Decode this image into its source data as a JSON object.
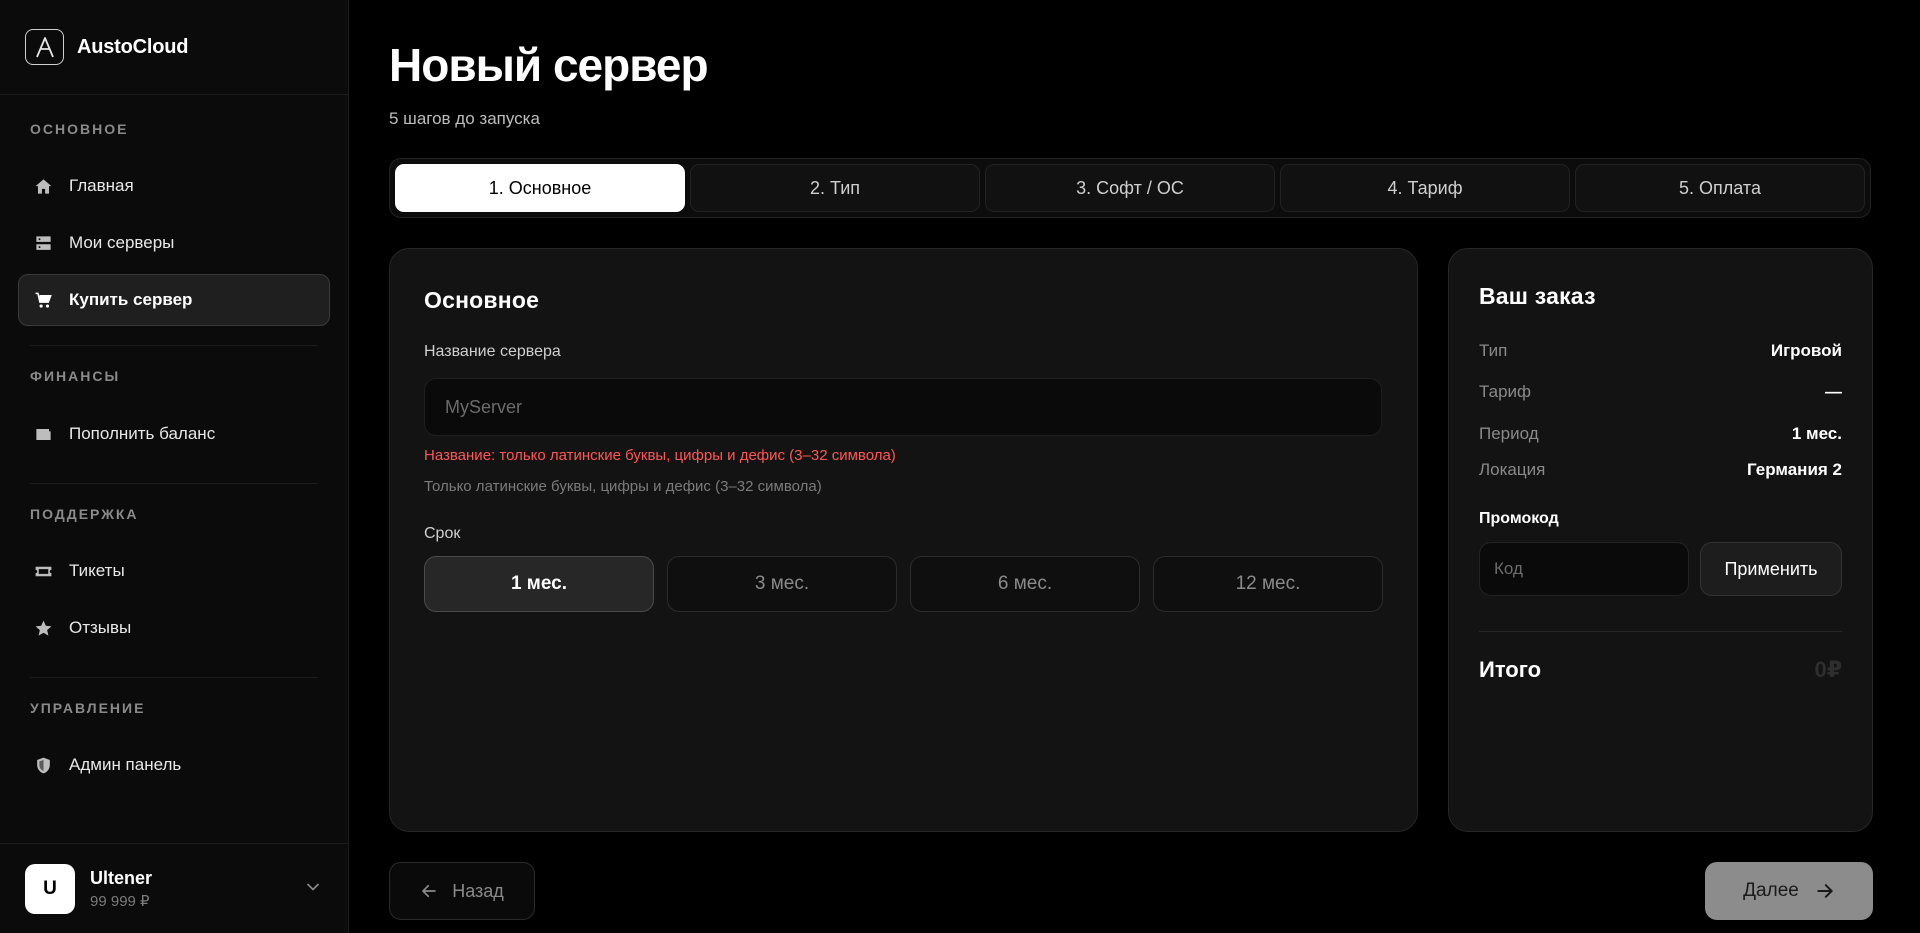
{
  "brand": {
    "logo_letter": "A",
    "name": "AustoCloud"
  },
  "sidebar": {
    "sections": [
      {
        "header": "ОСНОВНОЕ",
        "items": [
          {
            "label": "Главная",
            "icon": "home-icon"
          },
          {
            "label": "Мои серверы",
            "icon": "server-icon"
          },
          {
            "label": "Купить сервер",
            "icon": "cart-icon",
            "active": true
          }
        ]
      },
      {
        "header": "ФИНАНСЫ",
        "items": [
          {
            "label": "Пополнить баланс",
            "icon": "wallet-icon"
          }
        ]
      },
      {
        "header": "ПОДДЕРЖКА",
        "items": [
          {
            "label": "Тикеты",
            "icon": "ticket-icon"
          },
          {
            "label": "Отзывы",
            "icon": "star-icon"
          }
        ]
      },
      {
        "header": "УПРАВЛЕНИЕ",
        "items": [
          {
            "label": "Админ панель",
            "icon": "shield-icon"
          }
        ]
      }
    ]
  },
  "user": {
    "initial": "U",
    "name": "Ultener",
    "balance": "99 999 ₽"
  },
  "page": {
    "title": "Новый сервер",
    "subtitle": "5 шагов до запуска"
  },
  "steps": [
    {
      "label": "1. Основное",
      "active": true
    },
    {
      "label": "2. Тип"
    },
    {
      "label": "3. Софт / ОС"
    },
    {
      "label": "4. Тариф"
    },
    {
      "label": "5. Оплата"
    }
  ],
  "form": {
    "title": "Основное",
    "name_label": "Название сервера",
    "name_placeholder": "MyServer",
    "name_value": "",
    "error": "Название: только латинские буквы, цифры и дефис (3–32 символа)",
    "hint": "Только латинские буквы, цифры и дефис (3–32 символа)",
    "period_label": "Срок",
    "periods": [
      {
        "label": "1 мес.",
        "active": true
      },
      {
        "label": "3 мес."
      },
      {
        "label": "6 мес."
      },
      {
        "label": "12 мес."
      }
    ]
  },
  "order": {
    "title": "Ваш заказ",
    "rows": [
      {
        "key": "Тип",
        "value": "Игровой"
      },
      {
        "key": "Тариф",
        "value": "—"
      },
      {
        "key": "Период",
        "value": "1 мес."
      },
      {
        "key": "Локация",
        "value": "Германия 2"
      }
    ],
    "promo_label": "Промокод",
    "promo_placeholder": "Код",
    "promo_button": "Применить",
    "total_label": "Итого",
    "total_value": "0₽"
  },
  "actions": {
    "back": "Назад",
    "next": "Далее"
  },
  "colors": {
    "background": "#000000",
    "error": "#ff5757",
    "active_step": "#ffffff"
  }
}
